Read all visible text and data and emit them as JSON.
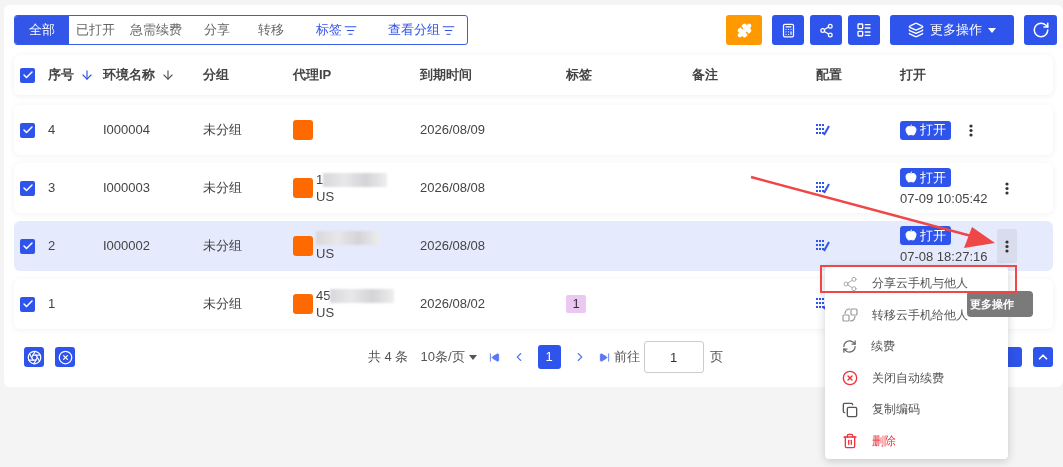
{
  "tabs": [
    {
      "label": "全部",
      "selected": true,
      "kind": "plain"
    },
    {
      "label": "已打开",
      "selected": false,
      "kind": "plain"
    },
    {
      "label": "急需续费",
      "selected": false,
      "kind": "plain"
    },
    {
      "label": "分享",
      "selected": false,
      "kind": "plain"
    },
    {
      "label": "转移",
      "selected": false,
      "kind": "plain"
    },
    {
      "label": "标签",
      "selected": false,
      "kind": "filter"
    },
    {
      "label": "查看分组",
      "selected": false,
      "kind": "filter"
    }
  ],
  "toolbar": {
    "more_actions": "更多操作"
  },
  "table": {
    "all_checked": true,
    "columns": [
      {
        "label": "序号",
        "sorted": true
      },
      {
        "label": "环境名称",
        "sorted": false
      },
      {
        "label": "分组"
      },
      {
        "label": "代理IP"
      },
      {
        "label": "到期时间"
      },
      {
        "label": "标签"
      },
      {
        "label": "备注"
      },
      {
        "label": "配置"
      },
      {
        "label": "打开"
      }
    ],
    "rows": [
      {
        "checked": true,
        "selected": false,
        "no": "4",
        "name": "I000004",
        "group": "未分组",
        "ip": "",
        "country": "",
        "expiry": "2026/08/09",
        "tag": "",
        "open": "打开",
        "last_opened": ""
      },
      {
        "checked": true,
        "selected": false,
        "no": "3",
        "name": "I000003",
        "group": "未分组",
        "ip": "1",
        "country": "US",
        "expiry": "2026/08/08",
        "tag": "",
        "open": "打开",
        "last_opened": "07-09 10:05:42"
      },
      {
        "checked": true,
        "selected": true,
        "no": "2",
        "name": "I000002",
        "group": "未分组",
        "ip": "",
        "country": "US",
        "expiry": "2026/08/08",
        "tag": "",
        "open": "打开",
        "last_opened": "07-08 18:27:16"
      },
      {
        "checked": true,
        "selected": false,
        "no": "1",
        "name": "",
        "group": "未分组",
        "ip": "45",
        "country": "US",
        "expiry": "2026/08/02",
        "tag": "1",
        "open": "",
        "last_opened": ""
      }
    ]
  },
  "menu": {
    "items": [
      {
        "label": "分享云手机与他人",
        "kind": "share"
      },
      {
        "label": "转移云手机给他人",
        "kind": "transfer"
      },
      {
        "label": "续费",
        "kind": "renew"
      },
      {
        "label": "关闭自动续费",
        "kind": "cancel"
      },
      {
        "label": "复制编码",
        "kind": "copy"
      },
      {
        "label": "删除",
        "kind": "delete"
      }
    ]
  },
  "tooltip": "更多操作",
  "pagination": {
    "total": "共 4 条",
    "page_size": "10条/页",
    "pages": [
      {
        "label": "1",
        "selected": true
      }
    ],
    "goto": "前往",
    "goto_value": "1",
    "page_unit": "页"
  }
}
